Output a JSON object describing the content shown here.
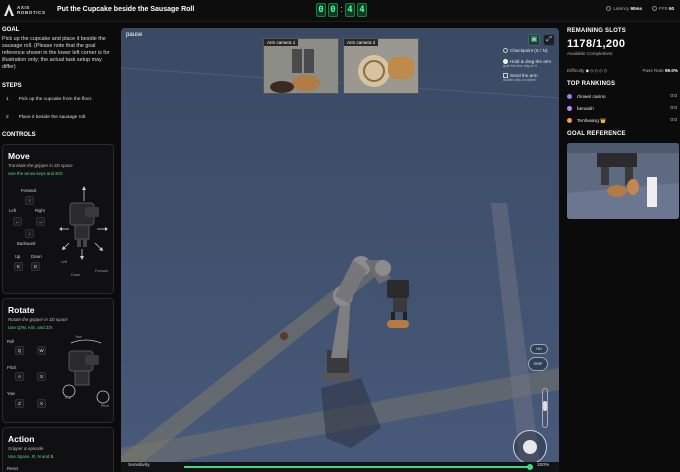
{
  "header": {
    "logo_line1": "AXIS",
    "logo_line2": "ROBOTICS",
    "task_title": "Put the Cupcake beside the Sausage Roll",
    "timer_digits": [
      "0",
      "0",
      "4",
      "4"
    ],
    "latency_label": "Latency",
    "latency_value": "90ms",
    "fps_label": "FPS",
    "fps_value": "60"
  },
  "left": {
    "goal_heading": "GOAL",
    "goal_text": "Pick up the cupcake and place it beside the sausage roll. (Please note that the goal reference shown in the lower left corner is for illustration only; the actual task setup may differ)",
    "steps_heading": "STEPS",
    "steps": [
      {
        "num": "1",
        "text": "Pick up the cupcake from the floor."
      },
      {
        "num": "2",
        "text": "Place it beside the sausage roll."
      }
    ],
    "controls_heading": "CONTROLS",
    "move": {
      "title": "Move",
      "subtitle": "Translate the gripper in 3D space",
      "hint": "Use the arrow keys and E/D",
      "forward": "Forward",
      "left": "Left",
      "right": "Right",
      "backward": "Backward",
      "up": "Up",
      "down": "Down",
      "key_e": "E",
      "key_d": "D",
      "viz_left": "Left",
      "viz_down": "Down",
      "viz_forward": "Forward"
    },
    "rotate": {
      "title": "Rotate",
      "subtitle": "Rotate the gripper in 3D space",
      "hint": "Use Q/W, A/S, and Z/X",
      "roll": "Roll",
      "pitch": "Pitch",
      "yaw": "Yaw",
      "keys": [
        "Q",
        "W",
        "A",
        "S",
        "Z",
        "X"
      ],
      "viz_yaw": "Yaw",
      "viz_roll": "Roll",
      "viz_pitch": "Pitch"
    },
    "action": {
      "title": "Action",
      "subtitle": "Gripper & episode",
      "hint": "Use Space, R, N and B",
      "reset": "Reset"
    }
  },
  "viewport": {
    "pause_label": "pause",
    "cam1_label": "Arm camera 1",
    "cam2_label": "Arm camera 2",
    "checkpoint": "Checkpoint (S / N)",
    "hold_drag": "Hold & drag the arm",
    "hold_drag_sub": "grab the blue ring on it",
    "send_arm": "Send the arm",
    "send_arm_sub": "double-click on object",
    "btn_home": "HH",
    "btn_grip": "GRIP",
    "sensitivity_label": "Sensitivity",
    "sensitivity_value": "100%",
    "sensitivity_level": 0.99
  },
  "right": {
    "remaining_heading": "REMAINING SLOTS",
    "slots_value": "1178/1,200",
    "slots_sub": "Available Completions",
    "difficulty_label": "Difficulty",
    "difficulty_stars": "◆◇◇◇◇",
    "pass_label": "Pass Rate",
    "pass_value": "99.0%",
    "rankings_heading": "TOP RANKINGS",
    "rankings": [
      {
        "name": "rhowel carino",
        "time": "0:0",
        "color": "#9a7cf0"
      },
      {
        "name": "benaish",
        "time": "0:0",
        "color": "#b98df6"
      },
      {
        "name": "Tenhwang 👑",
        "time": "0:0",
        "color": "#f0a050"
      }
    ],
    "goal_ref_heading": "GOAL REFERENCE"
  },
  "colors": {
    "accent_green": "#3ddc84",
    "timer_green": "#4dff9a",
    "viewport_blue": "#3c4d69"
  }
}
